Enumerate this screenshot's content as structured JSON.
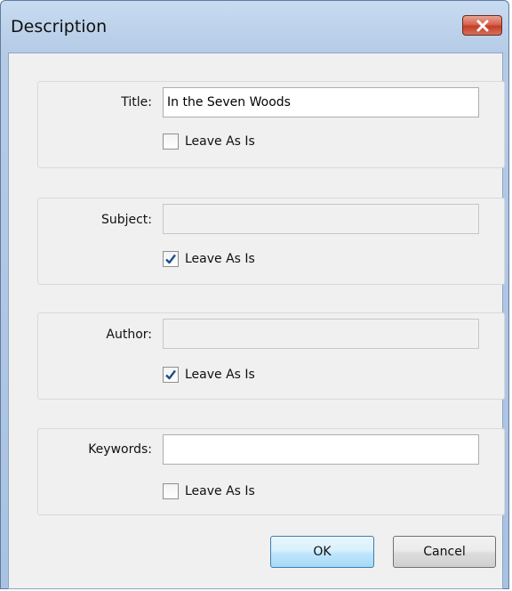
{
  "window": {
    "title": "Description"
  },
  "groups": {
    "title": {
      "label": "Title:",
      "value": "In the Seven Woods",
      "checkbox_label": "Leave As Is",
      "checked": false,
      "enabled": true
    },
    "subject": {
      "label": "Subject:",
      "value": "",
      "checkbox_label": "Leave As Is",
      "checked": true,
      "enabled": false
    },
    "author": {
      "label": "Author:",
      "value": "",
      "checkbox_label": "Leave As Is",
      "checked": true,
      "enabled": false
    },
    "keywords": {
      "label": "Keywords:",
      "value": "",
      "checkbox_label": "Leave As Is",
      "checked": false,
      "enabled": true
    }
  },
  "buttons": {
    "ok": "OK",
    "cancel": "Cancel"
  },
  "icons": {
    "close": "close-icon",
    "check": "checkmark-icon"
  },
  "colors": {
    "close_button": "#c9452e",
    "checkmark": "#1e4e8c",
    "default_button_border": "#3c7fb1"
  }
}
